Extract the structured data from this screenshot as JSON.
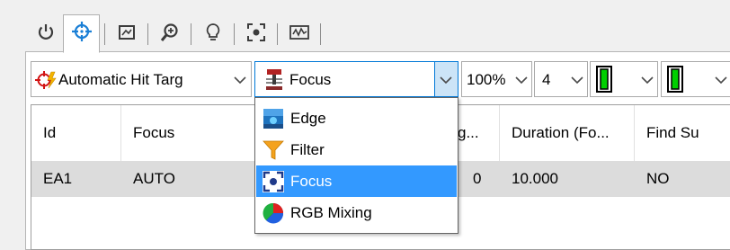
{
  "tabs": [
    {
      "icon": "power-icon",
      "active": false
    },
    {
      "icon": "crosshair-target-icon",
      "active": true
    },
    {
      "icon": "image-frame-icon",
      "active": false
    },
    {
      "icon": "magnify-plus-icon",
      "active": false
    },
    {
      "icon": "lightbulb-icon",
      "active": false
    },
    {
      "icon": "focus-frame-icon",
      "active": false
    },
    {
      "icon": "waveform-camera-icon",
      "active": false
    }
  ],
  "toolbar": {
    "target_mode": "Automatic Hit Targ",
    "tool": "Focus",
    "zoom": "100%",
    "count": "4",
    "colors": {
      "accent": "#0078d7",
      "green": "#00d000",
      "selection": "#3399ff"
    }
  },
  "table": {
    "headers": [
      "Id",
      "Focus",
      "g...",
      "Duration (Fo...",
      "Find Su"
    ],
    "rows": [
      [
        "EA1",
        "AUTO",
        "0",
        "10.000",
        "NO"
      ]
    ]
  },
  "dropdown": {
    "items": [
      {
        "label": "Edge",
        "icon": "edge-icon",
        "selected": false
      },
      {
        "label": "Filter",
        "icon": "funnel-filter-icon",
        "selected": false
      },
      {
        "label": "Focus",
        "icon": "focus-target-icon",
        "selected": true
      },
      {
        "label": "RGB Mixing",
        "icon": "rgb-mixing-icon",
        "selected": false
      }
    ]
  }
}
